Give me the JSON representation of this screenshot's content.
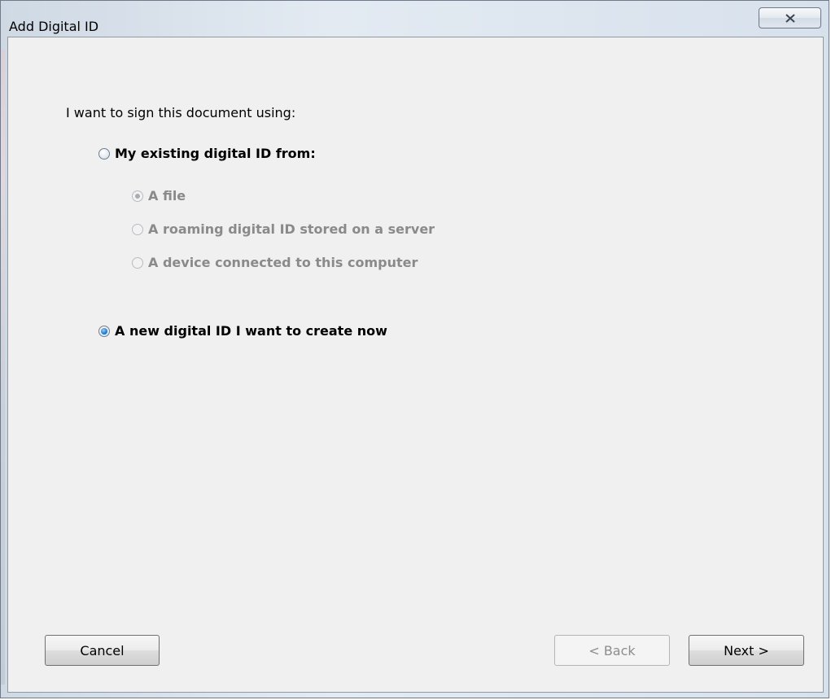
{
  "window": {
    "title": "Add Digital ID",
    "close_icon": "close-icon"
  },
  "prompt": "I want to sign this document using:",
  "options": {
    "existing": {
      "label": "My existing digital ID from:",
      "selected": false,
      "enabled": true
    },
    "sub_options": [
      {
        "label": "A file",
        "selected": true,
        "enabled": false
      },
      {
        "label": "A roaming digital ID stored on a server",
        "selected": false,
        "enabled": false
      },
      {
        "label": "A device connected to this computer",
        "selected": false,
        "enabled": false
      }
    ],
    "new_id": {
      "label": "A new digital ID I want to create now",
      "selected": true,
      "enabled": true
    }
  },
  "buttons": {
    "cancel": "Cancel",
    "back": "< Back",
    "next": "Next >"
  },
  "colors": {
    "radio_selected": "#2a7fd0",
    "disabled_text": "#8a8a8a"
  }
}
